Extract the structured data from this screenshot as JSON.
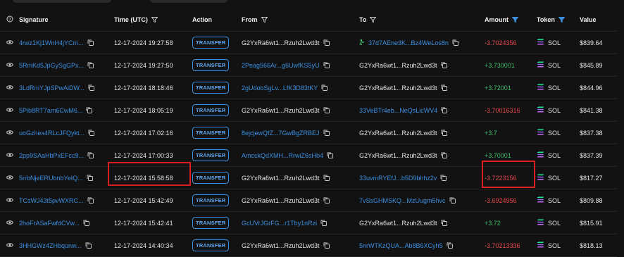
{
  "headers": {
    "info": "",
    "signature": "Signature",
    "time": "Time (UTC)",
    "action": "Action",
    "from": "From",
    "to": "To",
    "amount": "Amount",
    "token": "Token",
    "value": "Value"
  },
  "colors": {
    "accent": "#3b8fe0",
    "negative": "#e5484d",
    "positive": "#3fbf6a",
    "highlight": "#d81e1e"
  },
  "rows": [
    {
      "signature": "4rwz1Kj1WnH4jYCm...",
      "time": "12-17-2024 19:27:58",
      "action": "TRANSFER",
      "from": "G2YxRa6wt1...Rzuh2Lwd3t",
      "from_link": false,
      "to": "37d7AEne3K...Bz4WeLos8n",
      "to_link": true,
      "to_icon": "transfer-arrows-icon",
      "amount": "-3.7024356",
      "sign": "neg",
      "token": "SOL",
      "value": "$839.64"
    },
    {
      "signature": "5RmKd5JpGySgGPx...",
      "time": "12-17-2024 19:27:50",
      "action": "TRANSFER",
      "from": "2Peag566Ar...g6UwfKS5yU",
      "from_link": true,
      "to": "G2YxRa6wt1...Rzuh2Lwd3t",
      "to_link": false,
      "amount": "+3.730001",
      "sign": "pos",
      "token": "SOL",
      "value": "$845.89"
    },
    {
      "signature": "3LdRmYJpSPwAiDW...",
      "time": "12-17-2024 18:18:46",
      "action": "TRANSFER",
      "from": "2gUdobSgLv...LfK3D83tKY",
      "from_link": true,
      "to": "G2YxRa6wt1...Rzuh2Lwd3t",
      "to_link": false,
      "amount": "+3.72001",
      "sign": "pos",
      "token": "SOL",
      "value": "$844.96"
    },
    {
      "signature": "5Pib8RT7am6CwM6...",
      "time": "12-17-2024 18:05:19",
      "action": "TRANSFER",
      "from": "G2YxRa6wt1...Rzuh2Lwd3t",
      "from_link": false,
      "to": "33VeBTr4eb...NeQsLicWV4",
      "to_link": true,
      "amount": "-3.70016316",
      "sign": "neg",
      "token": "SOL",
      "value": "$841.38"
    },
    {
      "signature": "uoGzhex4RLcJFQykt...",
      "time": "12-17-2024 17:02:16",
      "action": "TRANSFER",
      "from": "8ejcjewQfZ...7GwBgZRBEJ",
      "from_link": true,
      "to": "G2YxRa6wt1...Rzuh2Lwd3t",
      "to_link": false,
      "amount": "+3.7",
      "sign": "pos",
      "token": "SOL",
      "value": "$837.38"
    },
    {
      "signature": "2pp9SAaHbPxEFcc9...",
      "time": "12-17-2024 17:00:33",
      "action": "TRANSFER",
      "from": "AmcckQdXMH...RrwiZ6sHb4",
      "from_link": true,
      "to": "G2YxRa6wt1...Rzuh2Lwd3t",
      "to_link": false,
      "amount": "+3.70001",
      "sign": "pos",
      "token": "SOL",
      "value": "$837.39"
    },
    {
      "signature": "5rrbNjeERUbnbYetQ...",
      "time": "12-17-2024 15:58:58",
      "action": "TRANSFER",
      "from": "G2YxRa6wt1...Rzuh2Lwd3t",
      "from_link": false,
      "to": "33uvmRYEfJ...b5D9bhhz2v",
      "to_link": true,
      "amount": "-3.7223156",
      "sign": "neg",
      "token": "SOL",
      "value": "$817.27"
    },
    {
      "signature": "TCsWJ43t5pvWXRC...",
      "time": "12-17-2024 15:42:49",
      "action": "TRANSFER",
      "from": "G2YxRa6wt1...Rzuh2Lwd3t",
      "from_link": false,
      "to": "7vSsGHMSKQ...MzUugm5hvc",
      "to_link": true,
      "amount": "-3.6924956",
      "sign": "neg",
      "token": "SOL",
      "value": "$809.88"
    },
    {
      "signature": "2hoFrASaFwfdCVw...",
      "time": "12-17-2024 15:42:41",
      "action": "TRANSFER",
      "from": "GcUVrJGrFG...r1Tby1nRzi",
      "from_link": true,
      "to": "G2YxRa6wt1...Rzuh2Lwd3t",
      "to_link": false,
      "amount": "+3.72",
      "sign": "pos",
      "token": "SOL",
      "value": "$815.91"
    },
    {
      "signature": "3HHGWz4ZHbqunw...",
      "time": "12-17-2024 14:40:34",
      "action": "TRANSFER",
      "from": "G2YxRa6wt1...Rzuh2Lwd3t",
      "from_link": false,
      "to": "5nrWTKzQUA...Ab8B6XCyh5",
      "to_link": true,
      "amount": "-3.70213336",
      "sign": "neg",
      "token": "SOL",
      "value": "$818.13"
    }
  ]
}
